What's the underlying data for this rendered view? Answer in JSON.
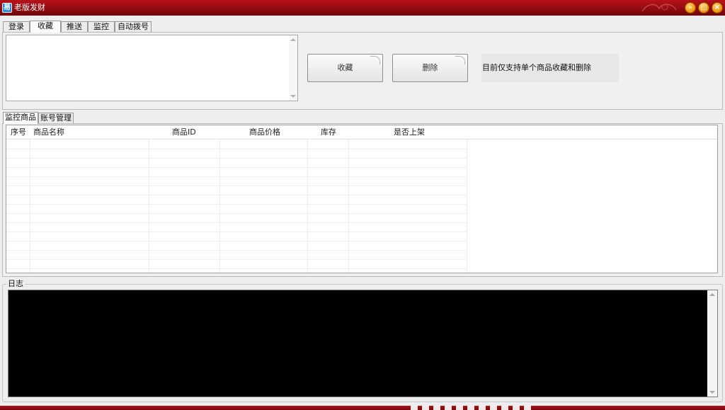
{
  "window": {
    "title": "老版发财",
    "app_icon_glyph": "易",
    "controls": {
      "minimize": "–",
      "maximize": "□",
      "close": "×"
    },
    "accent_color": "#a50f16"
  },
  "main_tabs": [
    {
      "label": "登录"
    },
    {
      "label": "收藏"
    },
    {
      "label": "推送"
    },
    {
      "label": "监控"
    },
    {
      "label": "自动拨号"
    }
  ],
  "favorites": {
    "input_value": "",
    "collect_button": "收藏",
    "delete_button": "删除",
    "notice": "目前仅支持单个商品收藏和删除"
  },
  "sub_tabs": [
    {
      "label": "监控商品"
    },
    {
      "label": "账号管理"
    }
  ],
  "table": {
    "columns": [
      "序号",
      "商品名称",
      "商品ID",
      "商品价格",
      "库存",
      "是否上架"
    ],
    "rows": []
  },
  "log": {
    "label": "日志",
    "content": ""
  }
}
